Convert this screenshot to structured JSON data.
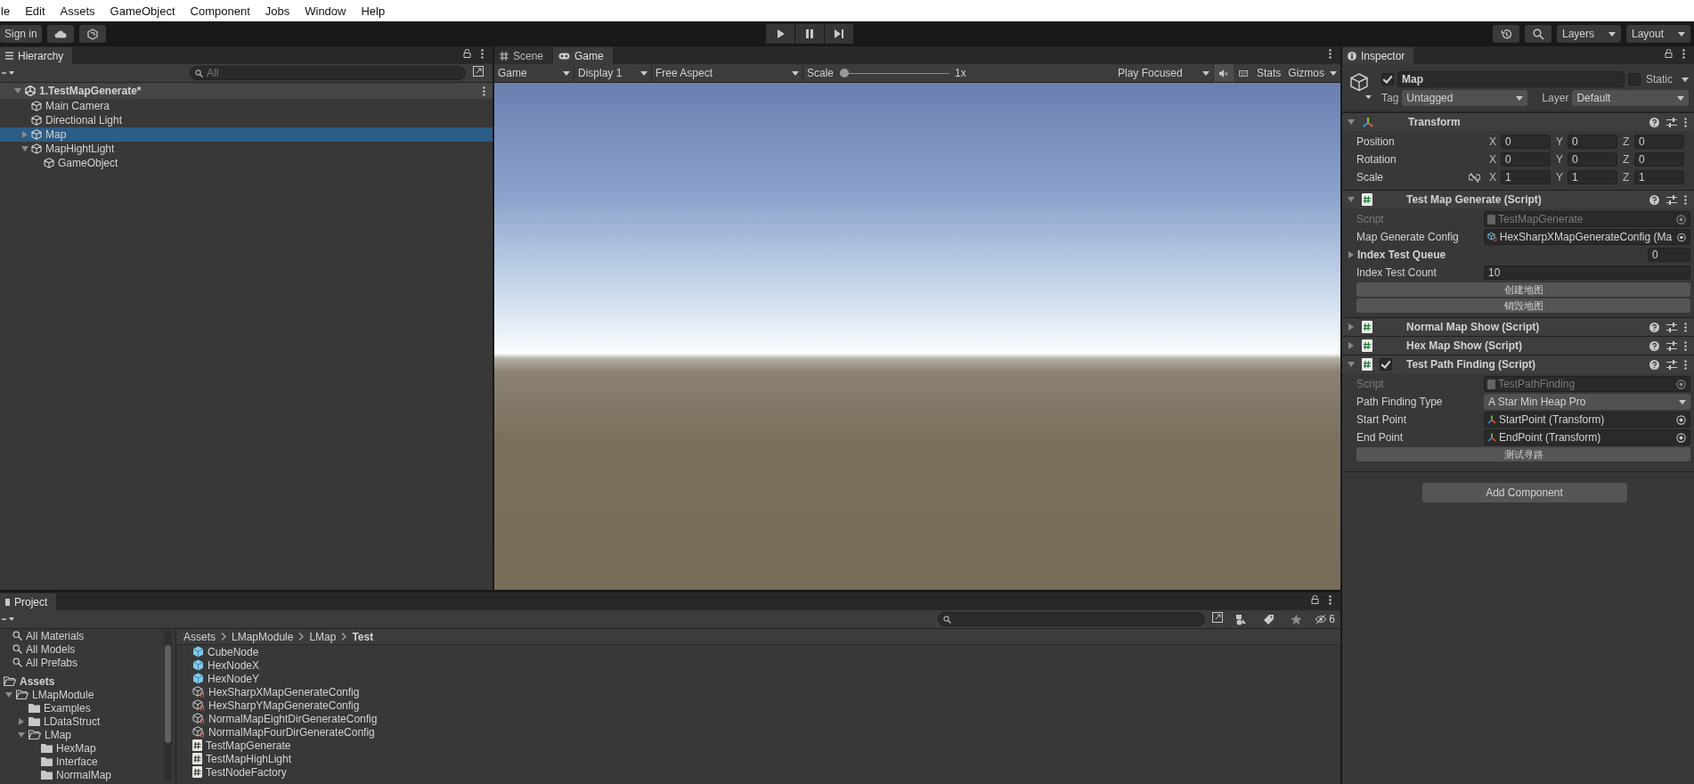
{
  "menu": [
    "le",
    "Edit",
    "Assets",
    "GameObject",
    "Component",
    "Jobs",
    "Window",
    "Help"
  ],
  "toolbar": {
    "sign_in": "Sign in",
    "layers": "Layers",
    "layout": "Layout"
  },
  "hierarchy": {
    "title": "Hierarchy",
    "search_placeholder": "All",
    "scene": {
      "name": "1.TestMapGenerate*",
      "expanded": true
    },
    "items": [
      {
        "name": "Main Camera",
        "selected": false
      },
      {
        "name": "Directional Light",
        "selected": false
      },
      {
        "name": "Map",
        "selected": true,
        "expanded": false
      },
      {
        "name": "MapHightLight",
        "selected": false,
        "expanded": true,
        "children": [
          {
            "name": "GameObject",
            "selected": false
          }
        ]
      }
    ]
  },
  "game": {
    "tabs": [
      {
        "label": "Scene",
        "kind": "scene",
        "selected": false
      },
      {
        "label": "Game",
        "kind": "game",
        "selected": true
      }
    ],
    "toolbar": {
      "view": "Game",
      "display": "Display 1",
      "aspect": "Free Aspect",
      "scale_label": "Scale",
      "scale": {
        "level": 0.0
      },
      "scale_value": "1x",
      "play_mode": "Play Focused",
      "stats": "Stats",
      "gizmos": "Gizmos"
    }
  },
  "inspector": {
    "title": "Inspector",
    "object": {
      "name": "Map",
      "active": true,
      "static_label": "Static",
      "static": false,
      "tag_label": "Tag",
      "tag": "Untagged",
      "layer_label": "Layer",
      "layer": "Default"
    },
    "components": [
      {
        "kind": "transform",
        "name": "Transform",
        "expanded": true,
        "rows": [
          {
            "kind": "vector3",
            "label": "Position",
            "values": [
              {
                "axis": "X",
                "value": "0"
              },
              {
                "axis": "Y",
                "value": "0"
              },
              {
                "axis": "Z",
                "value": "0"
              }
            ]
          },
          {
            "kind": "vector3",
            "label": "Rotation",
            "values": [
              {
                "axis": "X",
                "value": "0"
              },
              {
                "axis": "Y",
                "value": "0"
              },
              {
                "axis": "Z",
                "value": "0"
              }
            ]
          },
          {
            "kind": "vector3",
            "label": "Scale",
            "linked": false,
            "values": [
              {
                "axis": "X",
                "value": "1"
              },
              {
                "axis": "Y",
                "value": "1"
              },
              {
                "axis": "Z",
                "value": "1"
              }
            ]
          }
        ]
      },
      {
        "kind": "script",
        "name": "Test Map Generate (Script)",
        "expanded": true,
        "rows": [
          {
            "kind": "script_ref",
            "label": "Script",
            "value": "TestMapGenerate",
            "disabled": true
          },
          {
            "kind": "asset_ref",
            "label": "Map Generate Config",
            "value": "HexSharpXMapGenerateConfig (Ma",
            "disabled": false
          },
          {
            "kind": "list",
            "label": "Index Test Queue",
            "count": "0",
            "expanded": false
          },
          {
            "kind": "int",
            "label": "Index Test Count",
            "value": "10"
          },
          {
            "kind": "button",
            "label": "创建地图"
          },
          {
            "kind": "button",
            "label": "销毁地图"
          }
        ]
      },
      {
        "kind": "script",
        "name": "Normal Map Show (Script)",
        "expanded": false
      },
      {
        "kind": "script",
        "name": "Hex Map Show (Script)",
        "expanded": false
      },
      {
        "kind": "script",
        "name": "Test Path Finding (Script)",
        "expanded": true,
        "checked": true,
        "rows": [
          {
            "kind": "script_ref",
            "label": "Script",
            "value": "TestPathFinding",
            "disabled": true
          },
          {
            "kind": "enum",
            "label": "Path Finding Type",
            "value": "A Star Min Heap Pro"
          },
          {
            "kind": "transform_ref",
            "label": "Start Point",
            "value": "StartPoint (Transform)",
            "disabled": false
          },
          {
            "kind": "transform_ref",
            "label": "End Point",
            "value": "EndPoint (Transform)",
            "disabled": false
          },
          {
            "kind": "button",
            "label": "测试寻路"
          }
        ]
      }
    ],
    "add_component": "Add Component"
  },
  "project": {
    "title": "Project",
    "hidden_count": "6",
    "favorites": [
      "All Materials",
      "All Models",
      "All Prefabs"
    ],
    "tree": [
      {
        "name": "Assets",
        "expanded": true,
        "children": [
          {
            "name": "LMapModule",
            "expanded": true,
            "children": [
              {
                "name": "Examples"
              },
              {
                "name": "LDataStruct",
                "expanded": false
              },
              {
                "name": "LMap",
                "expanded": true,
                "children": [
                  {
                    "name": "HexMap"
                  },
                  {
                    "name": "Interface"
                  },
                  {
                    "name": "NormalMap"
                  }
                ]
              }
            ]
          }
        ]
      }
    ],
    "breadcrumb": [
      "Assets",
      "LMapModule",
      "LMap",
      "Test"
    ],
    "files": [
      {
        "name": "CubeNode",
        "kind": "prefab"
      },
      {
        "name": "HexNodeX",
        "kind": "prefab"
      },
      {
        "name": "HexNodeY",
        "kind": "prefab"
      },
      {
        "name": "HexSharpXMapGenerateConfig",
        "kind": "config"
      },
      {
        "name": "HexSharpYMapGenerateConfig",
        "kind": "config"
      },
      {
        "name": "NormalMapEightDirGenerateConfig",
        "kind": "config"
      },
      {
        "name": "NormalMapFourDirGenerateConfig",
        "kind": "config"
      },
      {
        "name": "TestMapGenerate",
        "kind": "script"
      },
      {
        "name": "TestMapHighLight",
        "kind": "script"
      },
      {
        "name": "TestNodeFactory",
        "kind": "script"
      }
    ]
  }
}
